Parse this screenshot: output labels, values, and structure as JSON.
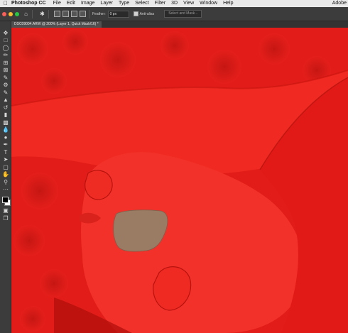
{
  "menubar": {
    "app_name": "Photoshop CC",
    "items": [
      "File",
      "Edit",
      "Image",
      "Layer",
      "Type",
      "Select",
      "Filter",
      "3D",
      "View",
      "Window",
      "Help"
    ],
    "right_text": "Adobe"
  },
  "options": {
    "feather_label": "Feather:",
    "feather_value": "0 px",
    "antialias_label": "Anti-alias",
    "select_mask_label": "Select and Mask..."
  },
  "document": {
    "tab_title": "DSC09004.ARW @ 200% (Layer 1, Quick Mask/16) *"
  },
  "colors": {
    "quick_mask_overlay": "#e8201c",
    "toolbar_bg": "#3c3c3c",
    "unmasked_patch": "#9a7b64"
  },
  "tools": [
    "move-tool-icon",
    "marquee-tool-icon",
    "lasso-tool-icon",
    "quick-selection-tool-icon",
    "crop-tool-icon",
    "frame-tool-icon",
    "eyedropper-tool-icon",
    "healing-brush-icon",
    "brush-tool-icon",
    "clone-stamp-icon",
    "history-brush-icon",
    "eraser-tool-icon",
    "gradient-tool-icon",
    "blur-tool-icon",
    "dodge-tool-icon",
    "pen-tool-icon",
    "type-tool-icon",
    "path-selection-icon",
    "rectangle-tool-icon",
    "hand-tool-icon",
    "zoom-tool-icon",
    "more-tools-icon",
    "quick-mask-icon",
    "screen-mode-icon"
  ]
}
